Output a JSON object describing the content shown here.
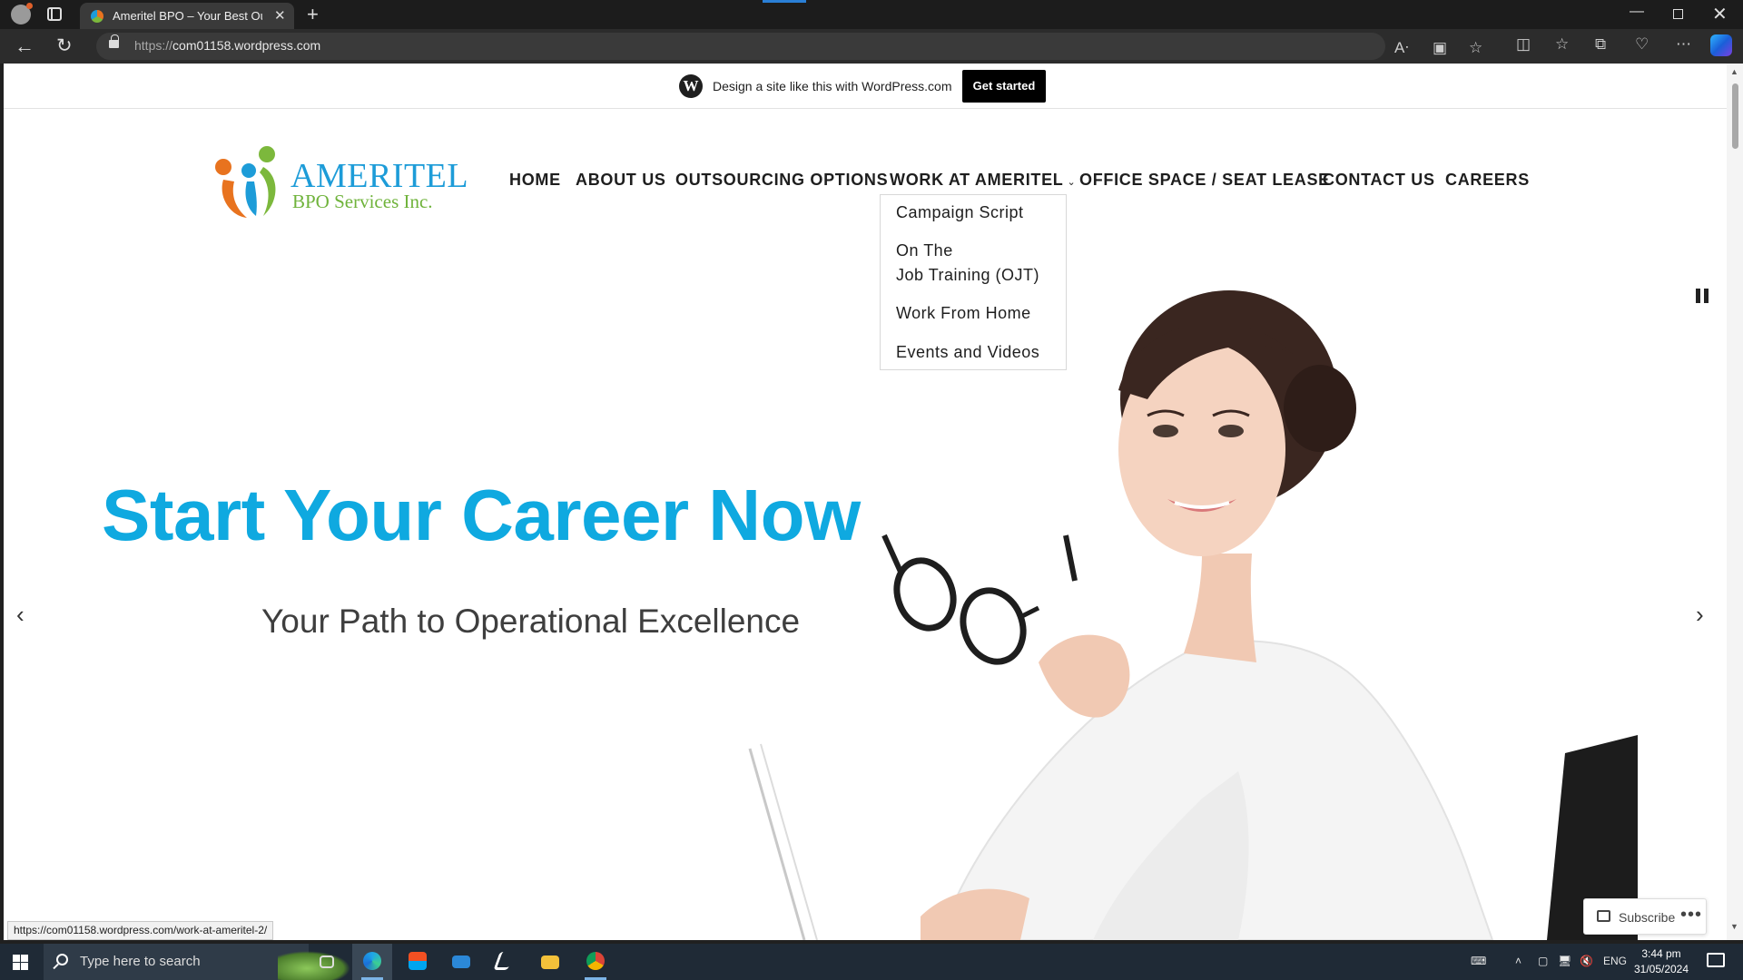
{
  "browser": {
    "tab_title": "Ameritel BPO – Your Best Outsou",
    "url_prefix": "https://",
    "url_host": "com01158.wordpress.com",
    "status_url": "https://com01158.wordpress.com/work-at-ameritel-2/"
  },
  "wp_banner": {
    "text": "Design a site like this with WordPress.com",
    "button": "Get started"
  },
  "logo": {
    "name": "AMERITEL",
    "sub": "BPO Services Inc."
  },
  "nav": {
    "items": [
      {
        "label": "HOME"
      },
      {
        "label": "ABOUT US"
      },
      {
        "label": "OUTSOURCING OPTIONS"
      },
      {
        "label": "WORK AT AMERITEL",
        "has_dropdown": true
      },
      {
        "label": "OFFICE SPACE / SEAT LEASE"
      },
      {
        "label": "CONTACT US"
      },
      {
        "label": "CAREERS"
      }
    ],
    "dropdown": [
      {
        "label": "Campaign Script"
      },
      {
        "label_line1": "On The",
        "label_line2": "Job Training (OJT)"
      },
      {
        "label": "Work From Home"
      },
      {
        "label": "Events and Videos"
      }
    ]
  },
  "hero": {
    "title": "Start Your Career Now",
    "subtitle": "Your Path to Operational Excellence"
  },
  "subscribe": {
    "label": "Subscribe"
  },
  "taskbar": {
    "search_placeholder": "Type here to search",
    "language": "ENG",
    "time": "3:44 pm",
    "date": "31/05/2024"
  },
  "colors": {
    "hero_title": "#0fa9e0",
    "logo_blue": "#1d9cd8",
    "logo_green": "#6fb33b",
    "logo_orange": "#e8731f"
  }
}
